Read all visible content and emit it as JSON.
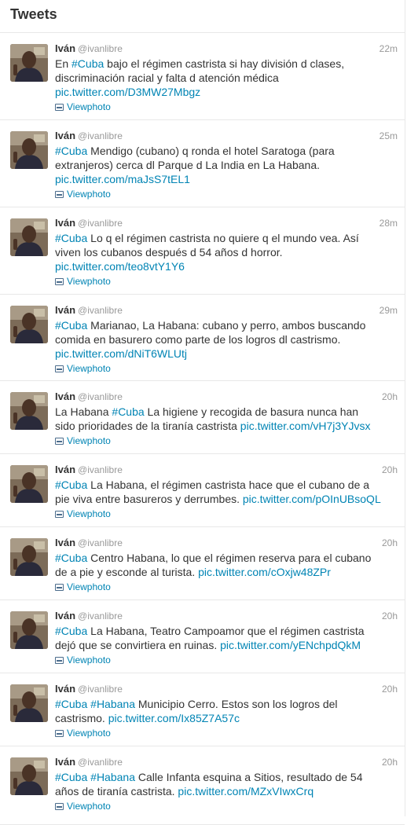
{
  "header": {
    "title": "Tweets"
  },
  "view_photo_label": "Viewphoto",
  "tweets": [
    {
      "name": "Iván",
      "handle": "@ivanlibre",
      "time": "22m",
      "lines": [
        [
          {
            "t": "text",
            "v": "En "
          },
          {
            "t": "hashtag",
            "v": "#Cuba"
          },
          {
            "t": "text",
            "v": " bajo el régimen castrista si hay división d clases,"
          }
        ],
        [
          {
            "t": "text",
            "v": "discriminación racial y falta d atención médica"
          }
        ],
        [
          {
            "t": "link",
            "v": "pic.twitter.com/D3MW27Mbgz"
          }
        ]
      ]
    },
    {
      "name": "Iván",
      "handle": "@ivanlibre",
      "time": "25m",
      "lines": [
        [
          {
            "t": "hashtag",
            "v": "#Cuba"
          },
          {
            "t": "text",
            "v": " Mendigo (cubano) q ronda el hotel Saratoga (para"
          }
        ],
        [
          {
            "t": "text",
            "v": "extranjeros) cerca dl Parque d La India en La Habana."
          }
        ],
        [
          {
            "t": "link",
            "v": "pic.twitter.com/maJsS7tEL1"
          }
        ]
      ]
    },
    {
      "name": "Iván",
      "handle": "@ivanlibre",
      "time": "28m",
      "lines": [
        [
          {
            "t": "hashtag",
            "v": "#Cuba"
          },
          {
            "t": "text",
            "v": " Lo q el régimen castrista no quiere q el mundo vea. Así"
          }
        ],
        [
          {
            "t": "text",
            "v": "viven los cubanos después d 54 años d horror."
          }
        ],
        [
          {
            "t": "link",
            "v": "pic.twitter.com/teo8vtY1Y6"
          }
        ]
      ]
    },
    {
      "name": "Iván",
      "handle": "@ivanlibre",
      "time": "29m",
      "lines": [
        [
          {
            "t": "hashtag",
            "v": "#Cuba"
          },
          {
            "t": "text",
            "v": " Marianao, La Habana: cubano y perro, ambos buscando"
          }
        ],
        [
          {
            "t": "text",
            "v": "comida en basurero como parte de los logros dl castrismo."
          }
        ],
        [
          {
            "t": "link",
            "v": "pic.twitter.com/dNiT6WLUtj"
          }
        ]
      ]
    },
    {
      "name": "Iván",
      "handle": "@ivanlibre",
      "time": "20h",
      "lines": [
        [
          {
            "t": "text",
            "v": "La Habana "
          },
          {
            "t": "hashtag",
            "v": "#Cuba"
          },
          {
            "t": "text",
            "v": " La higiene y recogida de basura nunca han"
          }
        ],
        [
          {
            "t": "text",
            "v": "sido prioridades de la tiranía castrista "
          },
          {
            "t": "link",
            "v": "pic.twitter.com/vH7j3YJvsx"
          }
        ]
      ]
    },
    {
      "name": "Iván",
      "handle": "@ivanlibre",
      "time": "20h",
      "lines": [
        [
          {
            "t": "hashtag",
            "v": "#Cuba"
          },
          {
            "t": "text",
            "v": " La Habana, el régimen castrista hace que el cubano de a"
          }
        ],
        [
          {
            "t": "text",
            "v": "pie viva entre basureros y derrumbes. "
          },
          {
            "t": "link",
            "v": "pic.twitter.com/pOInUBsoQL"
          }
        ]
      ]
    },
    {
      "name": "Iván",
      "handle": "@ivanlibre",
      "time": "20h",
      "lines": [
        [
          {
            "t": "hashtag",
            "v": "#Cuba"
          },
          {
            "t": "text",
            "v": " Centro Habana, lo que el régimen reserva para el cubano"
          }
        ],
        [
          {
            "t": "text",
            "v": "de a pie y esconde al turista. "
          },
          {
            "t": "link",
            "v": "pic.twitter.com/cOxjw48ZPr"
          }
        ]
      ]
    },
    {
      "name": "Iván",
      "handle": "@ivanlibre",
      "time": "20h",
      "lines": [
        [
          {
            "t": "hashtag",
            "v": "#Cuba"
          },
          {
            "t": "text",
            "v": " La Habana, Teatro Campoamor que el régimen castrista"
          }
        ],
        [
          {
            "t": "text",
            "v": "dejó que se convirtiera en ruinas. "
          },
          {
            "t": "link",
            "v": "pic.twitter.com/yENchpdQkM"
          }
        ]
      ]
    },
    {
      "name": "Iván",
      "handle": "@ivanlibre",
      "time": "20h",
      "lines": [
        [
          {
            "t": "hashtag",
            "v": "#Cuba"
          },
          {
            "t": "text",
            "v": " "
          },
          {
            "t": "hashtag",
            "v": "#Habana"
          },
          {
            "t": "text",
            "v": " Municipio Cerro. Estos son los logros del"
          }
        ],
        [
          {
            "t": "text",
            "v": "castrismo. "
          },
          {
            "t": "link",
            "v": "pic.twitter.com/Ix85Z7A57c"
          }
        ]
      ]
    },
    {
      "name": "Iván",
      "handle": "@ivanlibre",
      "time": "20h",
      "lines": [
        [
          {
            "t": "hashtag",
            "v": "#Cuba"
          },
          {
            "t": "text",
            "v": " "
          },
          {
            "t": "hashtag",
            "v": "#Habana"
          },
          {
            "t": "text",
            "v": " Calle Infanta esquina a Sitios, resultado de 54"
          }
        ],
        [
          {
            "t": "text",
            "v": "años de tiranía castrista. "
          },
          {
            "t": "link",
            "v": "pic.twitter.com/MZxVIwxCrq"
          }
        ]
      ]
    }
  ]
}
